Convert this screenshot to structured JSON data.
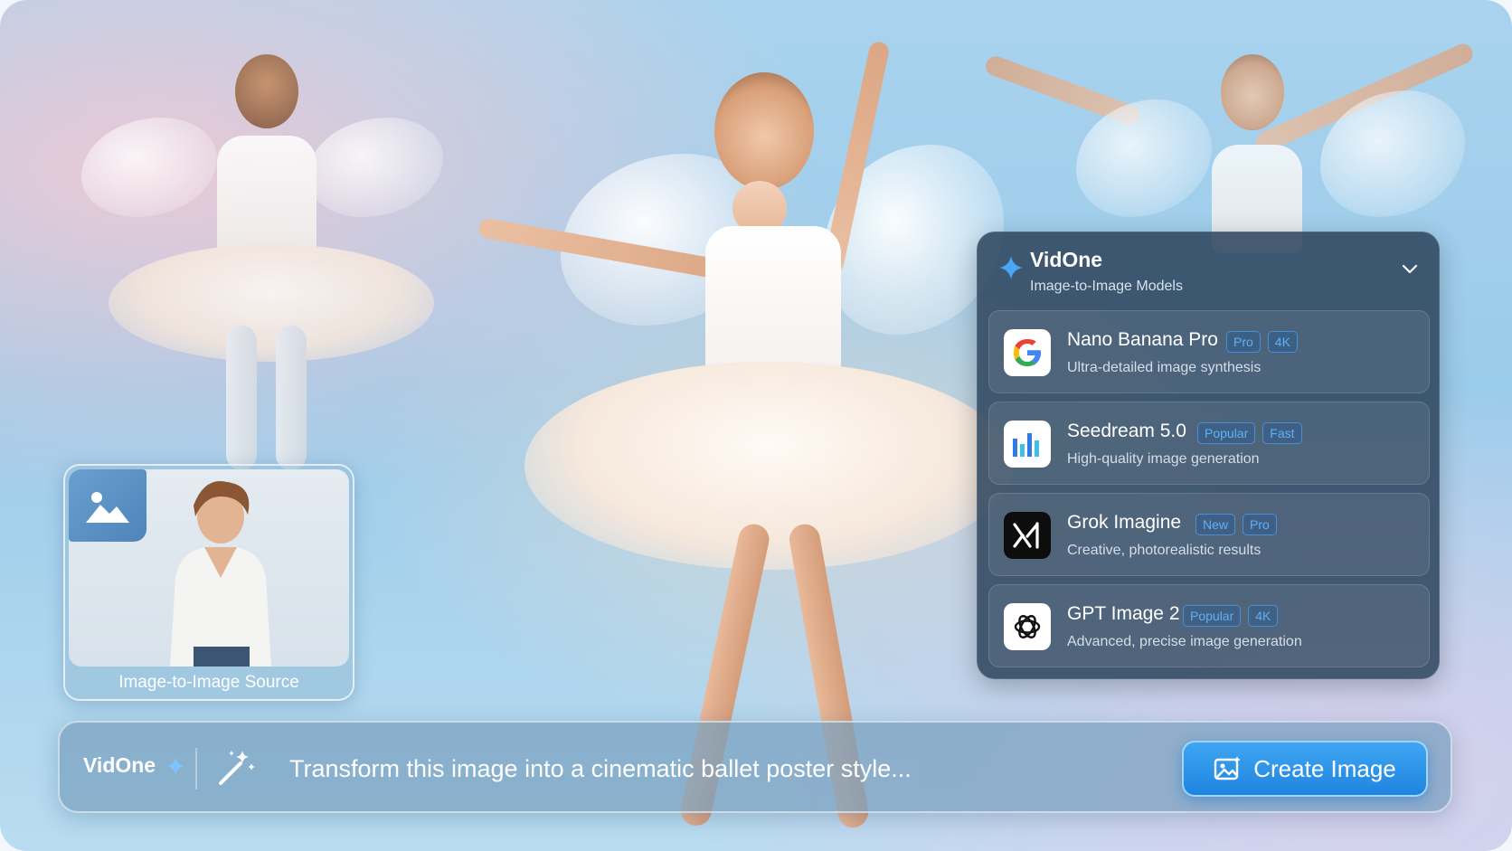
{
  "colors": {
    "accent": "#1f84e0",
    "badge": "#5fb0f7",
    "panel": "#2c445c"
  },
  "panel": {
    "title": "VidOne",
    "subtitle": "Image-to-Image Models",
    "models": [
      {
        "name": "Nano Banana Pro",
        "description": "Ultra-detailed image synthesis",
        "badges": [
          "Pro",
          "4K"
        ],
        "icon": "google-icon"
      },
      {
        "name": "Seedream 5.0",
        "description": "High-quality image generation",
        "badges": [
          "Popular",
          "Fast"
        ],
        "icon": "seedream-icon"
      },
      {
        "name": "Grok Imagine",
        "description": "Creative, photorealistic results",
        "badges": [
          "New",
          "Pro"
        ],
        "icon": "xai-icon"
      },
      {
        "name": "GPT Image 2",
        "description": "Advanced, precise image generation",
        "badges": [
          "Popular",
          "4K"
        ],
        "icon": "openai-icon"
      }
    ]
  },
  "source": {
    "label": "Image-to-Image Source"
  },
  "promptbar": {
    "brand": "VidOne",
    "prompt": "Transform this image into a cinematic ballet poster style...",
    "button_label": "Create Image"
  }
}
